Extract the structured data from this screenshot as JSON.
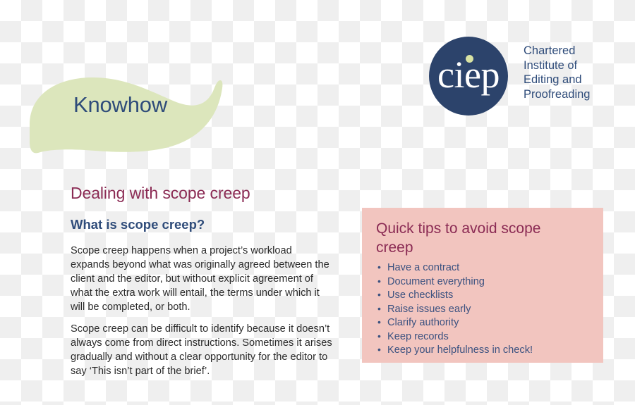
{
  "logo": {
    "wordmark": "ciep",
    "dot_icon": "green-dot",
    "name_lines": [
      "Chartered",
      "Institute of",
      "Editing and",
      "Proofreading"
    ],
    "circle_color": "#2c436b",
    "dot_color": "#d9e3a4",
    "text_color": "#2f4c7a"
  },
  "banner": {
    "label": "Knowhow",
    "shape": "leaf-blob",
    "fill_color": "#dce6bc",
    "text_color": "#2f4c7a"
  },
  "article": {
    "title": "Dealing with scope creep",
    "title_color": "#8b2b54",
    "section_heading": "What is scope creep?",
    "section_heading_color": "#2f4c7a",
    "paragraphs": [
      "Scope creep happens when a project’s workload expands beyond what was originally agreed between the client and the editor, but without explicit agreement of what the extra work will entail, the terms under which it will be completed, or both.",
      "Scope creep can be difficult to identify because it doesn’t always come from direct instructions. Sometimes it arises gradually and without a clear opportunity for the editor to say ‘This isn’t part of the brief’."
    ]
  },
  "quick_tips": {
    "heading": "Quick tips to avoid scope creep",
    "heading_color": "#8b2b54",
    "panel_color": "#f2c5bf",
    "item_color": "#3c5280",
    "items": [
      "Have a contract",
      "Document everything",
      "Use checklists",
      "Raise issues early",
      "Clarify authority",
      "Keep records",
      "Keep your helpfulness in check!"
    ]
  }
}
